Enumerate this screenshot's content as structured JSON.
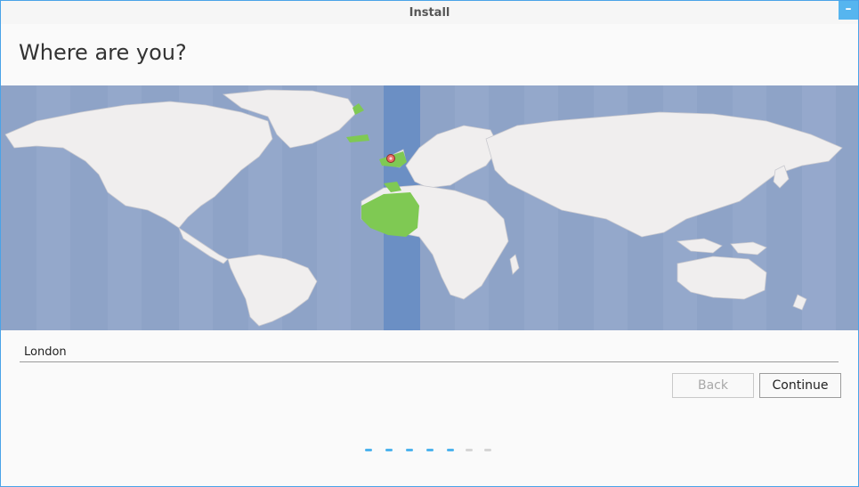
{
  "window": {
    "title": "Install",
    "minimize_label": "–"
  },
  "page": {
    "heading": "Where are you?"
  },
  "map": {
    "timezone_region": "Europe/London",
    "highlight_color": "#7fc953",
    "band_color": "#6b8fc4",
    "ocean_color": "#8ea3c7",
    "land_color": "#f0eeee",
    "pin_icon": "location-pin-icon"
  },
  "location": {
    "value": "London",
    "placeholder": ""
  },
  "buttons": {
    "back": "Back",
    "continue": "Continue"
  },
  "progress": {
    "total_steps": 7,
    "active_steps": 5,
    "active_color": "#4cb3ee",
    "inactive_color": "#d5d5d5"
  }
}
